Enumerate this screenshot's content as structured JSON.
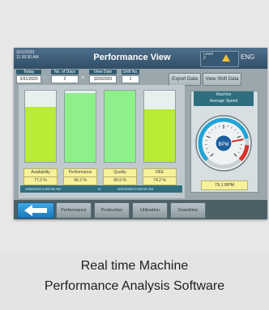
{
  "topbar": {
    "date_line1": "3/31/2020",
    "date_line2": "11:39:36 AM",
    "title": "Performance View",
    "level_label": "Level",
    "level_value": "2",
    "language": "ENG"
  },
  "controls": {
    "today_label": "Today",
    "today_value": "3/31/2020",
    "minus_symbol": "-",
    "days_label": "No. of Days",
    "days_value": "2",
    "equals_symbol": "=",
    "view_date_label": "View Date",
    "view_date_value": "3/29/2020",
    "shift_label": "Shift No.",
    "shift_value": "1",
    "export_button": "Export Data",
    "view_shift_button": "View Shift Data"
  },
  "metrics": [
    {
      "label": "Availability",
      "value": "77.2 %",
      "fill": 0.772,
      "color": "#b8ec37"
    },
    {
      "label": "Performance",
      "value": "96.2 %",
      "fill": 0.962,
      "color": "#8ef089"
    },
    {
      "label": "Quality",
      "value": "99.9 %",
      "fill": 0.999,
      "color": "#8ef089"
    },
    {
      "label": "OEE",
      "value": "74.2 %",
      "fill": 0.742,
      "color": "#b8ec37"
    }
  ],
  "range": {
    "from": "3/29/2020 6:00:00 AM",
    "to_word": "to",
    "to": "3/30/2020 6:00:00 AM"
  },
  "gauge": {
    "title_line1": "Machine",
    "title_line2": "Average Speed",
    "unit": "BPM",
    "value": 79.1,
    "max": 100,
    "readout": "79.1 BPM"
  },
  "nav": {
    "back_icon": "left-arrow-icon",
    "performance": "Performance",
    "production": "Production",
    "utilization": "Utilization",
    "downtime": "Downtime"
  },
  "caption": {
    "line1": "Real time Machine",
    "line2": "Performance Analysis Software"
  },
  "colors": {
    "accent": "#2f6e7f",
    "titlebar": "#3f5f78",
    "highlight": "#f7f19a"
  }
}
